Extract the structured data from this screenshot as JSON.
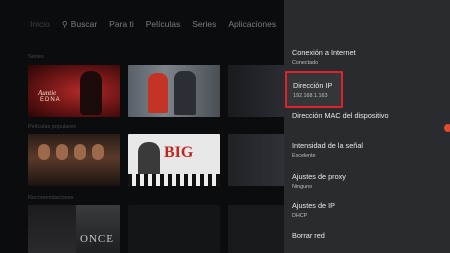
{
  "nav": {
    "items": [
      "Inicio",
      "Buscar",
      "Para ti",
      "Películas",
      "Series",
      "Aplicaciones"
    ]
  },
  "rows": {
    "row1_title": "Series",
    "row2_title": "Películas populares",
    "row3_title": "Recomendaciones"
  },
  "posters": {
    "edna_line1": "Auntie",
    "edna_line2": "EDNA",
    "big_title": "BIG",
    "once_title": "ONCE"
  },
  "settings": {
    "items": [
      {
        "title": "Conexión a Internet",
        "sub": "Conectado"
      },
      {
        "title": "Dirección IP",
        "sub": "192.168.1.163"
      },
      {
        "title": "Dirección MAC del dispositivo",
        "sub": ""
      },
      {
        "title": "Intensidad de la señal",
        "sub": "Excelente"
      },
      {
        "title": "Ajustes de proxy",
        "sub": "Ninguno"
      },
      {
        "title": "Ajustes de IP",
        "sub": "DHCP"
      },
      {
        "title": "Borrar red",
        "sub": ""
      }
    ],
    "highlight_color": "#e0232b"
  }
}
